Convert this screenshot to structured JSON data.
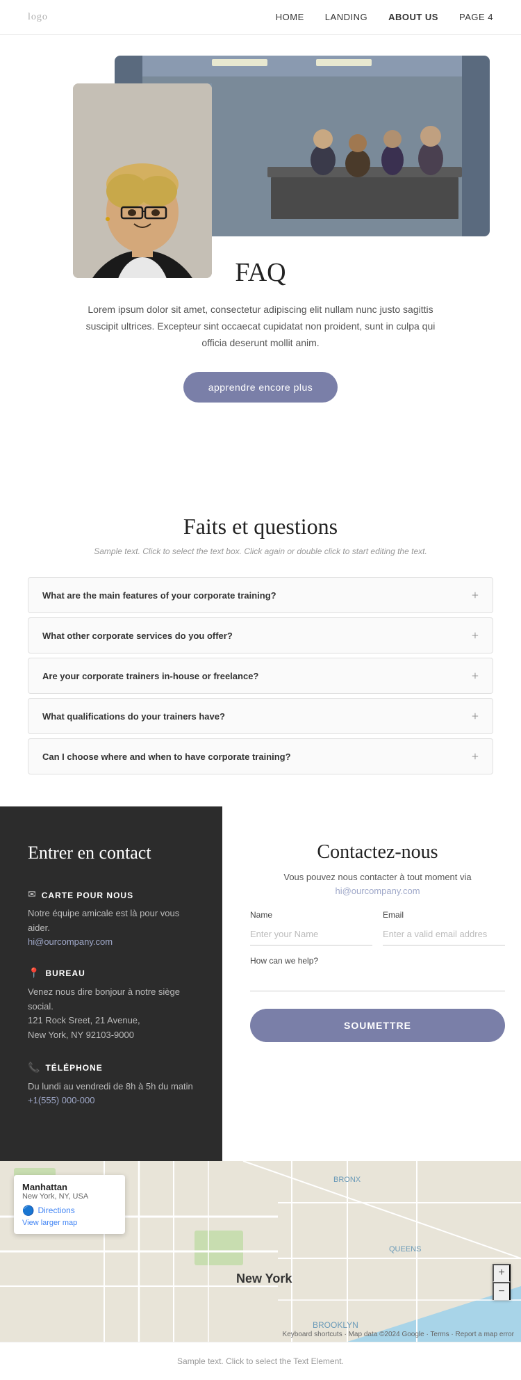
{
  "nav": {
    "logo": "logo",
    "links": [
      {
        "id": "home",
        "label": "HOME",
        "active": false
      },
      {
        "id": "landing",
        "label": "LANDING",
        "active": false
      },
      {
        "id": "about",
        "label": "ABOUT US",
        "active": true
      },
      {
        "id": "page4",
        "label": "PAGE 4",
        "active": false
      }
    ]
  },
  "hero": {
    "title": "FAQ",
    "description": "Lorem ipsum dolor sit amet, consectetur adipiscing elit nullam nunc justo sagittis suscipit ultrices. Excepteur sint occaecat cupidatat non proident, sunt in culpa qui officia deserunt mollit anim.",
    "button_label": "apprendre encore plus"
  },
  "faq_section": {
    "title": "Faits et questions",
    "subtitle": "Sample text. Click to select the text box. Click again or double click to start editing the text.",
    "items": [
      {
        "id": "faq1",
        "question": "What are the main features of your corporate training?"
      },
      {
        "id": "faq2",
        "question": "What other corporate services do you offer?"
      },
      {
        "id": "faq3",
        "question": "Are your corporate trainers in-house or freelance?"
      },
      {
        "id": "faq4",
        "question": "What qualifications do your trainers have?"
      },
      {
        "id": "faq5",
        "question": "Can I choose where and when to have corporate training?"
      }
    ]
  },
  "contact_left": {
    "title": "Entrer en contact",
    "items": [
      {
        "id": "carte",
        "icon": "✉",
        "label": "CARTE POUR NOUS",
        "text": "Notre équipe amicale est là pour vous aider.",
        "link": "hi@ourcompany.com"
      },
      {
        "id": "bureau",
        "icon": "📍",
        "label": "BUREAU",
        "text": "Venez nous dire bonjour à notre siège social.\n121 Rock Sreet, 21 Avenue,\nNew York, NY 92103-9000",
        "link": null
      },
      {
        "id": "telephone",
        "icon": "📞",
        "label": "TÉLÉPHONE",
        "text": "Du lundi au vendredi de 8h à 5h du matin",
        "link": "+1(555) 000-000"
      }
    ]
  },
  "contact_right": {
    "title": "Contactez-nous",
    "description": "Vous pouvez nous contacter à tout moment via",
    "email": "hi@ourcompany.com",
    "name_label": "Name",
    "name_placeholder": "Enter your Name",
    "email_label": "Email",
    "email_placeholder": "Enter a valid email addres",
    "help_label": "How can we help?",
    "help_placeholder": "",
    "submit_label": "SOUMETTRE"
  },
  "map": {
    "popup_title": "Manhattan",
    "popup_subtitle": "New York, NY, USA",
    "directions_label": "Directions",
    "larger_map_label": "View larger map"
  },
  "footer": {
    "text": "Sample text. Click to select the Text Element."
  },
  "colors": {
    "accent": "#7a7fa8",
    "dark_bg": "#2c2c2c",
    "link": "#9fa8c9"
  }
}
